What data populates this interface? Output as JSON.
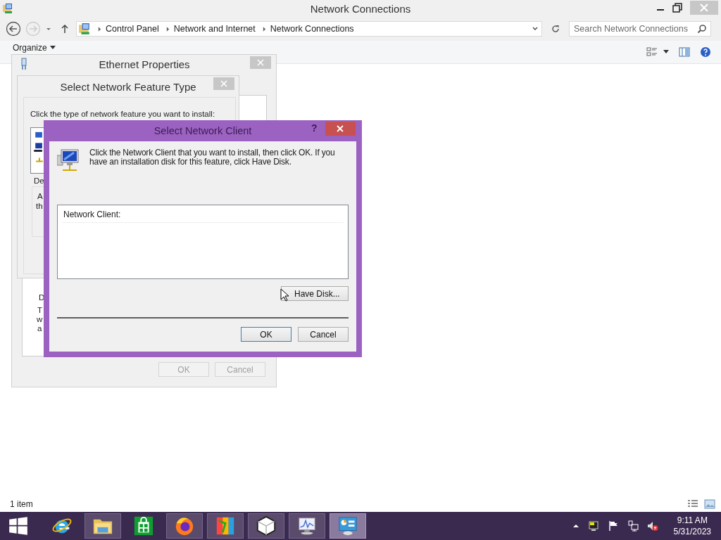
{
  "explorer": {
    "title": "Network Connections",
    "breadcrumb": [
      "Control Panel",
      "Network and Internet",
      "Network Connections"
    ],
    "search": {
      "placeholder": "Search Network Connections"
    },
    "organize": "Organize",
    "status": "1 item"
  },
  "ethernet_properties": {
    "title": "Ethernet Properties",
    "fragments": [
      "D",
      "T",
      "w",
      "a"
    ],
    "buttons": [
      {
        "label": "OK",
        "disabled": true
      },
      {
        "label": "Cancel",
        "disabled": true
      }
    ]
  },
  "feature_type": {
    "title": "Select Network Feature Type",
    "prompt": "Click the type of network feature you want to install:",
    "fragments": [
      "De",
      "A",
      "th"
    ]
  },
  "network_client": {
    "title": "Select Network Client",
    "help": "?",
    "instruction": "Click the Network Client that you want to install, then click OK. If you have an installation disk for this feature, click Have Disk.",
    "list_header": "Network Client:",
    "have_disk": "Have Disk...",
    "buttons": [
      {
        "label": "OK",
        "default": true
      },
      {
        "label": "Cancel",
        "default": false
      }
    ]
  },
  "taskbar": {
    "apps": [
      {
        "kind": "ie",
        "running": false,
        "selected": false
      },
      {
        "kind": "folder",
        "running": true,
        "selected": false
      },
      {
        "kind": "store",
        "running": false,
        "selected": false
      },
      {
        "kind": "firefox",
        "running": true,
        "selected": false
      },
      {
        "kind": "paint",
        "running": true,
        "selected": false
      },
      {
        "kind": "cube",
        "running": true,
        "selected": false
      },
      {
        "kind": "monitor",
        "running": true,
        "selected": false
      },
      {
        "kind": "control",
        "running": true,
        "selected": true
      }
    ],
    "clock": {
      "time": "9:11 AM",
      "date": "5/31/2023"
    }
  }
}
